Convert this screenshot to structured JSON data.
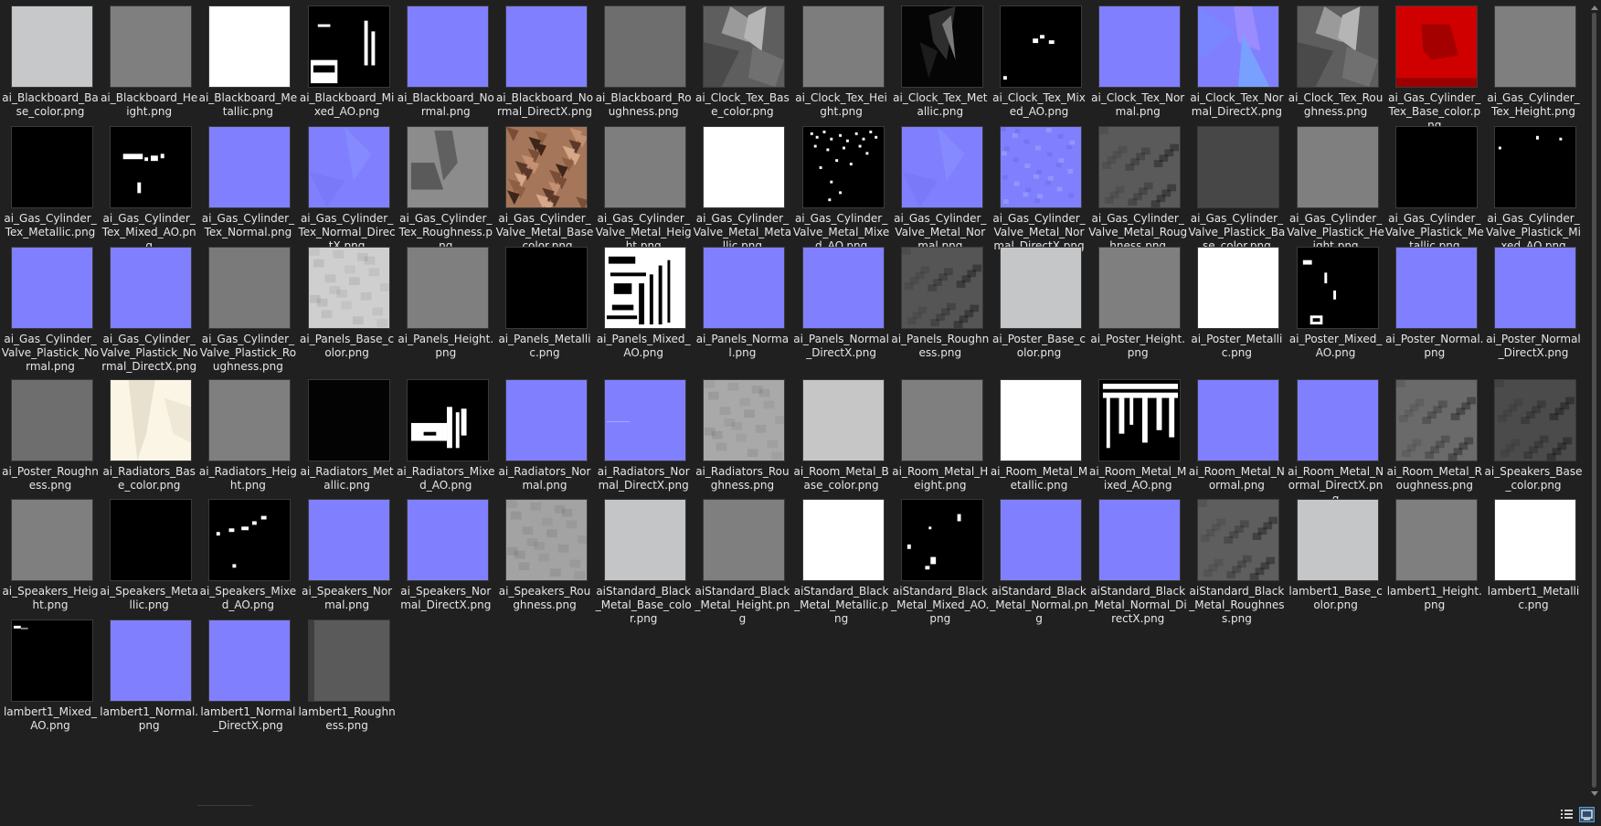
{
  "files": [
    {
      "name": "ai_Blackboard_Base_color.png",
      "thumb": "solid",
      "color": "#c7c8ca"
    },
    {
      "name": "ai_Blackboard_Height.png",
      "thumb": "solid",
      "color": "#7f7f7f"
    },
    {
      "name": "ai_Blackboard_Metallic.png",
      "thumb": "solid",
      "color": "#ffffff"
    },
    {
      "name": "ai_Blackboard_Mixed_AO.png",
      "thumb": "ao1",
      "color": "#000000"
    },
    {
      "name": "ai_Blackboard_Normal.png",
      "thumb": "normal",
      "color": "#8080ff"
    },
    {
      "name": "ai_Blackboard_Normal_DirectX.png",
      "thumb": "normal",
      "color": "#8080ff"
    },
    {
      "name": "ai_Blackboard_Roughness.png",
      "thumb": "solid",
      "color": "#6e6e6e"
    },
    {
      "name": "ai_Clock_Tex_Base_color.png",
      "thumb": "clockgray",
      "color": "#6a6a6a"
    },
    {
      "name": "ai_Clock_Tex_Height.png",
      "thumb": "solid",
      "color": "#7d7d7d"
    },
    {
      "name": "ai_Clock_Tex_Metallic.png",
      "thumb": "clockdark",
      "color": "#050505"
    },
    {
      "name": "ai_Clock_Tex_Mixed_AO.png",
      "thumb": "ao2",
      "color": "#000000"
    },
    {
      "name": "ai_Clock_Tex_Normal.png",
      "thumb": "normal",
      "color": "#8080ff"
    },
    {
      "name": "ai_Clock_Tex_Normal_DirectX.png",
      "thumb": "normalvar",
      "color": "#8080ff"
    },
    {
      "name": "ai_Clock_Tex_Roughness.png",
      "thumb": "clockgray",
      "color": "#6a6a6a"
    },
    {
      "name": "ai_Gas_Cylinder_Tex_Base_color.png",
      "thumb": "red",
      "color": "#d10000"
    },
    {
      "name": "ai_Gas_Cylinder_Tex_Height.png",
      "thumb": "solid",
      "color": "#7f7f7f"
    },
    {
      "name": "ai_Gas_Cylinder_Tex_Metallic.png",
      "thumb": "solid",
      "color": "#000000"
    },
    {
      "name": "ai_Gas_Cylinder_Tex_Mixed_AO.png",
      "thumb": "ao3",
      "color": "#000000"
    },
    {
      "name": "ai_Gas_Cylinder_Tex_Normal.png",
      "thumb": "normal",
      "color": "#8080ff"
    },
    {
      "name": "ai_Gas_Cylinder_Tex_Normal_DirectX.png",
      "thumb": "normalfaint",
      "color": "#8080ff"
    },
    {
      "name": "ai_Gas_Cylinder_Tex_Roughness.png",
      "thumb": "roughshape",
      "color": "#8c8c8c"
    },
    {
      "name": "ai_Gas_Cylinder_Valve_Metal_Base_color.png",
      "thumb": "copper",
      "color": "#a5765a"
    },
    {
      "name": "ai_Gas_Cylinder_Valve_Metal_Height.png",
      "thumb": "solid",
      "color": "#7e7e7e"
    },
    {
      "name": "ai_Gas_Cylinder_Valve_Metal_Metallic.png",
      "thumb": "solid",
      "color": "#ffffff"
    },
    {
      "name": "ai_Gas_Cylinder_Valve_Metal_Mixed_AO.png",
      "thumb": "aospeckle",
      "color": "#000000"
    },
    {
      "name": "ai_Gas_Cylinder_Valve_Metal_Normal.png",
      "thumb": "normalfaint",
      "color": "#8080ff"
    },
    {
      "name": "ai_Gas_Cylinder_Valve_Metal_Normal_DirectX.png",
      "thumb": "normalnoise",
      "color": "#8080ff"
    },
    {
      "name": "ai_Gas_Cylinder_Valve_Metal_Roughness.png",
      "thumb": "roughmottle",
      "color": "#5a5a5a"
    },
    {
      "name": "ai_Gas_Cylinder_Valve_Plastick_Base_color.png",
      "thumb": "solid",
      "color": "#474747"
    },
    {
      "name": "ai_Gas_Cylinder_Valve_Plastick_Height.png",
      "thumb": "solid",
      "color": "#7f7f7f"
    },
    {
      "name": "ai_Gas_Cylinder_Valve_Plastick_Metallic.png",
      "thumb": "solid",
      "color": "#000000"
    },
    {
      "name": "ai_Gas_Cylinder_Valve_Plastick_Mixed_AO.png",
      "thumb": "ao4",
      "color": "#000000"
    },
    {
      "name": "ai_Gas_Cylinder_Valve_Plastick_Normal.png",
      "thumb": "normal",
      "color": "#8080ff"
    },
    {
      "name": "ai_Gas_Cylinder_Valve_Plastick_Normal_DirectX.png",
      "thumb": "normal",
      "color": "#8080ff"
    },
    {
      "name": "ai_Gas_Cylinder_Valve_Plastick_Roughness.png",
      "thumb": "solid",
      "color": "#7a7a7a"
    },
    {
      "name": "ai_Panels_Base_color.png",
      "thumb": "lightmottle",
      "color": "#cfcfcf"
    },
    {
      "name": "ai_Panels_Height.png",
      "thumb": "solid",
      "color": "#7f7f7f"
    },
    {
      "name": "ai_Panels_Metallic.png",
      "thumb": "solid",
      "color": "#000000"
    },
    {
      "name": "ai_Panels_Mixed_AO.png",
      "thumb": "aopanels",
      "color": "#ffffff"
    },
    {
      "name": "ai_Panels_Normal.png",
      "thumb": "normal",
      "color": "#8080ff"
    },
    {
      "name": "ai_Panels_Normal_DirectX.png",
      "thumb": "normal",
      "color": "#8080ff"
    },
    {
      "name": "ai_Panels_Roughness.png",
      "thumb": "roughmottle",
      "color": "#555555"
    },
    {
      "name": "ai_Poster_Base_color.png",
      "thumb": "solid",
      "color": "#c5c6c8"
    },
    {
      "name": "ai_Poster_Height.png",
      "thumb": "solid",
      "color": "#7f7f7f"
    },
    {
      "name": "ai_Poster_Metallic.png",
      "thumb": "solid",
      "color": "#ffffff"
    },
    {
      "name": "ai_Poster_Mixed_AO.png",
      "thumb": "ao5",
      "color": "#000000"
    },
    {
      "name": "ai_Poster_Normal.png",
      "thumb": "normal",
      "color": "#8080ff"
    },
    {
      "name": "ai_Poster_Normal_DirectX.png",
      "thumb": "normal",
      "color": "#8080ff"
    },
    {
      "name": "ai_Poster_Roughness.png",
      "thumb": "solid",
      "color": "#6e6e6e"
    },
    {
      "name": "ai_Radiators_Base_color.png",
      "thumb": "cream",
      "color": "#fbf5e6"
    },
    {
      "name": "ai_Radiators_Height.png",
      "thumb": "solid",
      "color": "#7f7f7f"
    },
    {
      "name": "ai_Radiators_Metallic.png",
      "thumb": "solid",
      "color": "#030303"
    },
    {
      "name": "ai_Radiators_Mixed_AO.png",
      "thumb": "ao6",
      "color": "#000000"
    },
    {
      "name": "ai_Radiators_Normal.png",
      "thumb": "normal",
      "color": "#8080ff"
    },
    {
      "name": "ai_Radiators_Normal_DirectX.png",
      "thumb": "normalline",
      "color": "#8080ff"
    },
    {
      "name": "ai_Radiators_Roughness.png",
      "thumb": "lightmottle",
      "color": "#a9a9a9"
    },
    {
      "name": "ai_Room_Metal_Base_color.png",
      "thumb": "solid",
      "color": "#c6c6c6"
    },
    {
      "name": "ai_Room_Metal_Height.png",
      "thumb": "solid",
      "color": "#7f7f7f"
    },
    {
      "name": "ai_Room_Metal_Metallic.png",
      "thumb": "solid",
      "color": "#ffffff"
    },
    {
      "name": "ai_Room_Metal_Mixed_AO.png",
      "thumb": "aoroom",
      "color": "#000000"
    },
    {
      "name": "ai_Room_Metal_Normal.png",
      "thumb": "normal",
      "color": "#8080ff"
    },
    {
      "name": "ai_Room_Metal_Normal_DirectX.png",
      "thumb": "normal",
      "color": "#8080ff"
    },
    {
      "name": "ai_Room_Metal_Roughness.png",
      "thumb": "roughmottle",
      "color": "#6a6a6a"
    },
    {
      "name": "ai_Speakers_Base_color.png",
      "thumb": "roughmottle",
      "color": "#4b4b4b"
    },
    {
      "name": "ai_Speakers_Height.png",
      "thumb": "solid",
      "color": "#7f7f7f"
    },
    {
      "name": "ai_Speakers_Metallic.png",
      "thumb": "solid",
      "color": "#000000"
    },
    {
      "name": "ai_Speakers_Mixed_AO.png",
      "thumb": "ao7",
      "color": "#000000"
    },
    {
      "name": "ai_Speakers_Normal.png",
      "thumb": "normal",
      "color": "#8080ff"
    },
    {
      "name": "ai_Speakers_Normal_DirectX.png",
      "thumb": "normal",
      "color": "#8080ff"
    },
    {
      "name": "ai_Speakers_Roughness.png",
      "thumb": "lightmottle",
      "color": "#a3a3a3"
    },
    {
      "name": "aiStandard_Black_Metal_Base_color.png",
      "thumb": "solid",
      "color": "#c4c5c7"
    },
    {
      "name": "aiStandard_Black_Metal_Height.png",
      "thumb": "solid",
      "color": "#7f7f7f"
    },
    {
      "name": "aiStandard_Black_Metal_Metallic.png",
      "thumb": "solid",
      "color": "#ffffff"
    },
    {
      "name": "aiStandard_Black_Metal_Mixed_AO.png",
      "thumb": "ao8",
      "color": "#000000"
    },
    {
      "name": "aiStandard_Black_Metal_Normal.png",
      "thumb": "normal",
      "color": "#8080ff"
    },
    {
      "name": "aiStandard_Black_Metal_Normal_DirectX.png",
      "thumb": "normal",
      "color": "#8080ff"
    },
    {
      "name": "aiStandard_Black_Metal_Roughness.png",
      "thumb": "roughmottle",
      "color": "#5e5e5e"
    },
    {
      "name": "lambert1_Base_color.png",
      "thumb": "solid",
      "color": "#c5c6c8"
    },
    {
      "name": "lambert1_Height.png",
      "thumb": "solid",
      "color": "#7f7f7f"
    },
    {
      "name": "lambert1_Metallic.png",
      "thumb": "solid",
      "color": "#ffffff"
    },
    {
      "name": "lambert1_Mixed_AO.png",
      "thumb": "ao9",
      "color": "#000000"
    },
    {
      "name": "lambert1_Normal.png",
      "thumb": "normal",
      "color": "#8080ff"
    },
    {
      "name": "lambert1_Normal_DirectX.png",
      "thumb": "normal",
      "color": "#8080ff"
    },
    {
      "name": "lambert1_Roughness.png",
      "thumb": "roughstripe",
      "color": "#5a5a5a"
    }
  ],
  "theme": {
    "background": "#202020",
    "label_color": "#e6e6e6",
    "selected_view_accent": "#5a9fd6"
  },
  "statusbar": {
    "view_buttons": [
      "details-view-icon",
      "large-icons-view-icon"
    ]
  }
}
